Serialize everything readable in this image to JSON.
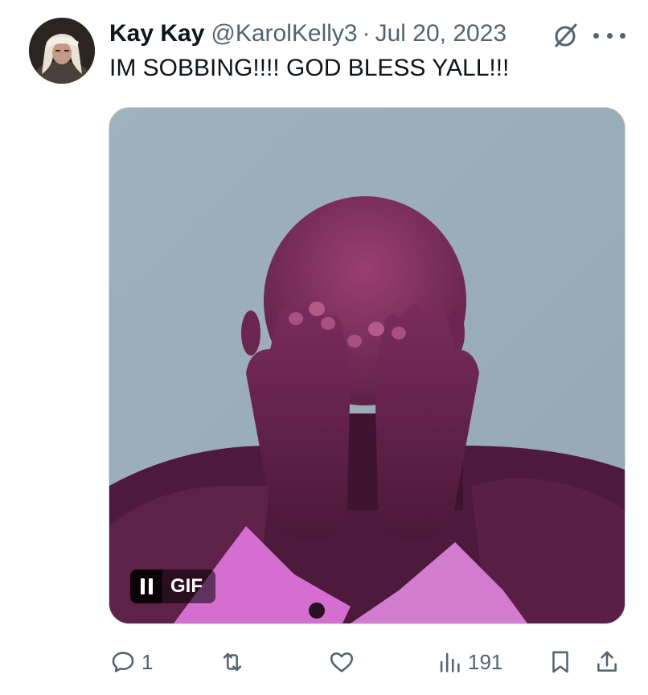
{
  "tweet": {
    "display_name": "Kay Kay",
    "handle": "@KarolKelly3",
    "separator": "·",
    "date": "Jul 20, 2023",
    "text": "IM SOBBING!!!! GOD BLESS YALL!!!"
  },
  "media": {
    "badge_label": "GIF"
  },
  "actions": {
    "replies": "1",
    "retweets": "",
    "likes": "",
    "views": "191"
  },
  "colors": {
    "text_primary": "#0f1419",
    "text_secondary": "#536471",
    "border": "#cfd9de",
    "media_background": "#9aacb6",
    "shirt": "#d46fd0"
  },
  "icons": {
    "grok": "grok-icon",
    "more": "more-icon",
    "reply": "reply-icon",
    "retweet": "retweet-icon",
    "like": "heart-icon",
    "views": "views-icon",
    "bookmark": "bookmark-icon",
    "share": "share-icon",
    "pause": "pause-icon"
  }
}
